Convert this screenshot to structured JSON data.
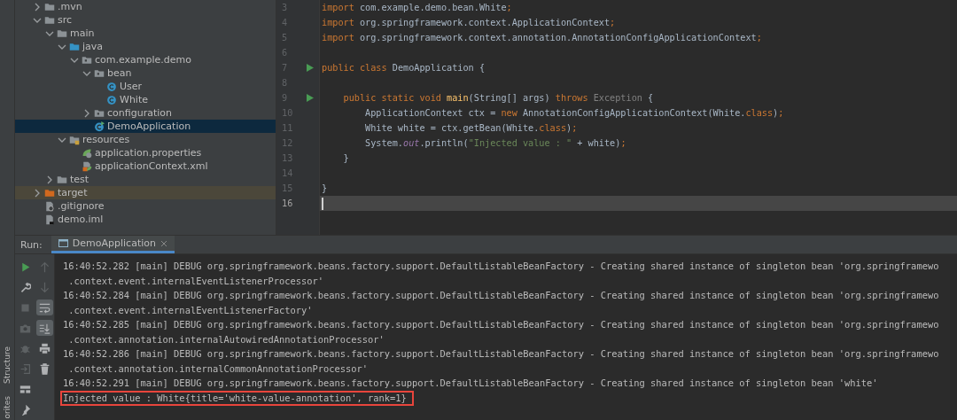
{
  "side_strip": {
    "labels": [
      "Structure",
      "orites"
    ]
  },
  "project_tree": {
    "items": [
      {
        "name": ".mvn",
        "kind": "folder",
        "expanded": false,
        "selected": false
      },
      {
        "name": "src",
        "kind": "folder",
        "expanded": true,
        "selected": false,
        "children": [
          {
            "name": "main",
            "kind": "folder",
            "expanded": true,
            "selected": false,
            "children": [
              {
                "name": "java",
                "kind": "source-folder",
                "expanded": true,
                "selected": false,
                "children": [
                  {
                    "name": "com.example.demo",
                    "kind": "package",
                    "expanded": true,
                    "selected": false,
                    "children": [
                      {
                        "name": "bean",
                        "kind": "package",
                        "expanded": true,
                        "selected": false,
                        "children": [
                          {
                            "name": "User",
                            "kind": "class",
                            "selected": false
                          },
                          {
                            "name": "White",
                            "kind": "class",
                            "selected": false
                          }
                        ]
                      },
                      {
                        "name": "configuration",
                        "kind": "package",
                        "expanded": false,
                        "selected": false
                      },
                      {
                        "name": "DemoApplication",
                        "kind": "main-class",
                        "selected": true
                      }
                    ]
                  }
                ]
              },
              {
                "name": "resources",
                "kind": "resources-folder",
                "expanded": true,
                "selected": false,
                "children": [
                  {
                    "name": "application.properties",
                    "kind": "properties",
                    "selected": false
                  },
                  {
                    "name": "applicationContext.xml",
                    "kind": "xml",
                    "selected": false
                  }
                ]
              }
            ]
          },
          {
            "name": "test",
            "kind": "folder",
            "expanded": false,
            "selected": false
          }
        ]
      },
      {
        "name": "target",
        "kind": "excluded-folder",
        "expanded": false,
        "selected": false
      },
      {
        "name": ".gitignore",
        "kind": "ignore-file",
        "selected": false
      },
      {
        "name": "demo.iml",
        "kind": "module-file",
        "selected": false
      }
    ]
  },
  "editor": {
    "lines": [
      {
        "number": "3",
        "runnable": false,
        "current": false,
        "tokens": [
          {
            "text": "import",
            "kind": "kw"
          },
          {
            "text": " com.example.demo.bean.White",
            "kind": "plain"
          },
          {
            "text": ";",
            "kind": "kw"
          }
        ]
      },
      {
        "number": "4",
        "runnable": false,
        "current": false,
        "tokens": [
          {
            "text": "import",
            "kind": "kw"
          },
          {
            "text": " org.springframework.context.ApplicationContext",
            "kind": "plain"
          },
          {
            "text": ";",
            "kind": "kw"
          }
        ]
      },
      {
        "number": "5",
        "runnable": false,
        "current": false,
        "tokens": [
          {
            "text": "import",
            "kind": "kw"
          },
          {
            "text": " org.springframework.context.annotation.AnnotationConfigApplicationContext",
            "kind": "plain"
          },
          {
            "text": ";",
            "kind": "kw"
          }
        ]
      },
      {
        "number": "6",
        "runnable": false,
        "current": false
      },
      {
        "number": "7",
        "runnable": true,
        "current": false,
        "tokens": [
          {
            "text": "public class",
            "kind": "kw"
          },
          {
            "text": " DemoApplication {",
            "kind": "plain"
          }
        ]
      },
      {
        "number": "8",
        "runnable": false,
        "current": false
      },
      {
        "number": "9",
        "runnable": true,
        "current": false,
        "tokens": [
          {
            "text": "    public static void",
            "kind": "kw"
          },
          {
            "text": " main",
            "kind": "fn"
          },
          {
            "text": "(String[] args) ",
            "kind": "plain"
          },
          {
            "text": "throws",
            "kind": "kw"
          },
          {
            "text": " Exception",
            "kind": "muted"
          },
          {
            "text": " {",
            "kind": "plain"
          }
        ]
      },
      {
        "number": "10",
        "runnable": false,
        "current": false,
        "tokens": [
          {
            "text": "        ApplicationContext ctx = ",
            "kind": "plain"
          },
          {
            "text": "new",
            "kind": "kw"
          },
          {
            "text": " AnnotationConfigApplicationContext(White.",
            "kind": "plain"
          },
          {
            "text": "class",
            "kind": "kw"
          },
          {
            "text": ")",
            "kind": "plain"
          },
          {
            "text": ";",
            "kind": "kw"
          }
        ]
      },
      {
        "number": "11",
        "runnable": false,
        "current": false,
        "tokens": [
          {
            "text": "        White white = ctx.getBean(White.",
            "kind": "plain"
          },
          {
            "text": "class",
            "kind": "kw"
          },
          {
            "text": ")",
            "kind": "plain"
          },
          {
            "text": ";",
            "kind": "kw"
          }
        ]
      },
      {
        "number": "12",
        "runnable": false,
        "current": false,
        "tokens": [
          {
            "text": "        System.",
            "kind": "plain"
          },
          {
            "text": "out",
            "kind": "field"
          },
          {
            "text": ".println(",
            "kind": "plain"
          },
          {
            "text": "\"Injected value : \"",
            "kind": "str"
          },
          {
            "text": " + white)",
            "kind": "plain"
          },
          {
            "text": ";",
            "kind": "kw"
          }
        ]
      },
      {
        "number": "13",
        "runnable": false,
        "current": false,
        "tokens": [
          {
            "text": "    }",
            "kind": "plain"
          }
        ]
      },
      {
        "number": "14",
        "runnable": false,
        "current": false
      },
      {
        "number": "15",
        "runnable": false,
        "current": false,
        "tokens": [
          {
            "text": "}",
            "kind": "plain"
          }
        ]
      },
      {
        "number": "16",
        "runnable": false,
        "current": true
      }
    ]
  },
  "run_panel": {
    "label": "Run:",
    "tab": {
      "title": "DemoApplication",
      "selected": true
    },
    "toolbar_left": [
      {
        "kind": "run",
        "disabled": false
      },
      {
        "kind": "wrench",
        "disabled": false
      },
      {
        "kind": "stop",
        "disabled": true
      },
      {
        "kind": "camera",
        "disabled": true
      },
      {
        "kind": "bug",
        "disabled": true
      },
      {
        "kind": "exit",
        "disabled": true
      },
      {
        "kind": "layout",
        "disabled": false
      },
      {
        "kind": "pin",
        "disabled": false
      }
    ],
    "toolbar_right": [
      {
        "kind": "up",
        "on": false,
        "disabled": true
      },
      {
        "kind": "down",
        "on": false,
        "disabled": true
      },
      {
        "kind": "wrap",
        "on": true,
        "disabled": false
      },
      {
        "kind": "scroll-end",
        "on": true,
        "disabled": false
      },
      {
        "kind": "print",
        "on": false,
        "disabled": false
      },
      {
        "kind": "trash",
        "on": false,
        "disabled": false
      }
    ],
    "console": {
      "lines": [
        {
          "text": "16:40:52.282 [main] DEBUG org.springframework.beans.factory.support.DefaultListableBeanFactory - Creating shared instance of singleton bean 'org.springframewo",
          "highlighted": false
        },
        {
          "text": " .context.event.internalEventListenerProcessor'",
          "highlighted": false
        },
        {
          "text": "16:40:52.284 [main] DEBUG org.springframework.beans.factory.support.DefaultListableBeanFactory - Creating shared instance of singleton bean 'org.springframewo",
          "highlighted": false
        },
        {
          "text": " .context.event.internalEventListenerFactory'",
          "highlighted": false
        },
        {
          "text": "16:40:52.285 [main] DEBUG org.springframework.beans.factory.support.DefaultListableBeanFactory - Creating shared instance of singleton bean 'org.springframewo",
          "highlighted": false
        },
        {
          "text": " .context.annotation.internalAutowiredAnnotationProcessor'",
          "highlighted": false
        },
        {
          "text": "16:40:52.286 [main] DEBUG org.springframework.beans.factory.support.DefaultListableBeanFactory - Creating shared instance of singleton bean 'org.springframewo",
          "highlighted": false
        },
        {
          "text": " .context.annotation.internalCommonAnnotationProcessor'",
          "highlighted": false
        },
        {
          "text": "16:40:52.291 [main] DEBUG org.springframework.beans.factory.support.DefaultListableBeanFactory - Creating shared instance of singleton bean 'white'",
          "highlighted": false
        },
        {
          "text": "Injected value : White{title='white-value-annotation', rank=1}",
          "highlighted": true
        }
      ]
    }
  }
}
